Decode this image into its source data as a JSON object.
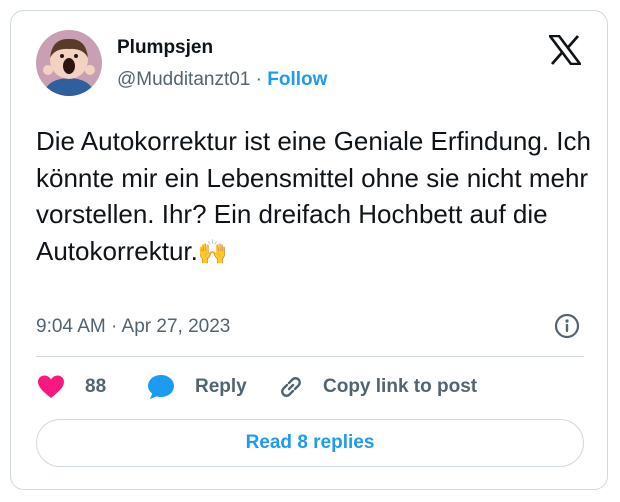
{
  "author": {
    "display_name": "Plumpsjen",
    "handle": "@Mudditanzt01",
    "separator": "·",
    "follow_label": "Follow"
  },
  "tweet": {
    "text": "Die Autokorrektur ist eine Geniale Erfindung. Ich könnte mir ein Lebensmittel ohne sie nicht mehr vorstellen. Ihr? Ein dreifach Hochbett auf die Autokorrektur.",
    "emoji": "🙌",
    "timestamp": "9:04 AM · Apr 27, 2023"
  },
  "actions": {
    "like_count": "88",
    "reply_label": "Reply",
    "copy_label": "Copy link to post"
  },
  "footer": {
    "read_replies_label": "Read 8 replies"
  },
  "icons": {
    "avatar": "avatar-image",
    "platform": "x-logo-icon",
    "info": "info-icon",
    "like": "heart-icon",
    "reply": "speech-bubble-icon",
    "copy": "link-icon"
  },
  "colors": {
    "accent": "#1d9bf0",
    "like": "#f91880",
    "text": "#0f1419",
    "muted": "#536471",
    "border": "#cfd9de"
  }
}
